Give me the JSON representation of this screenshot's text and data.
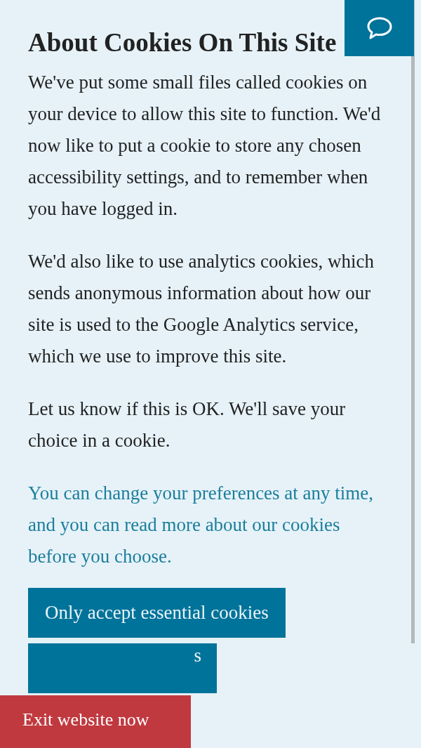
{
  "heading": "About Cookies On This Site",
  "paragraphs": [
    {
      "kind": "text",
      "text": "We've put some small files called cookies on your device to allow this site to function. We'd now like to put a cookie to store any chosen accessibility settings, and to remember when you have logged in."
    },
    {
      "kind": "text",
      "text": "We'd also like to use analytics cookies, which sends anonymous information about how our site is used to the Google Analytics service, which we use to improve this site."
    },
    {
      "kind": "text",
      "text": "Let us know if this is OK. We'll save your choice in a cookie."
    },
    {
      "kind": "link",
      "text": "You can change your preferences at any time, and you can read more about our cookies before you choose."
    }
  ],
  "buttons": [
    "Only accept essential cookies",
    "s"
  ],
  "exit_button": "Exit website now"
}
